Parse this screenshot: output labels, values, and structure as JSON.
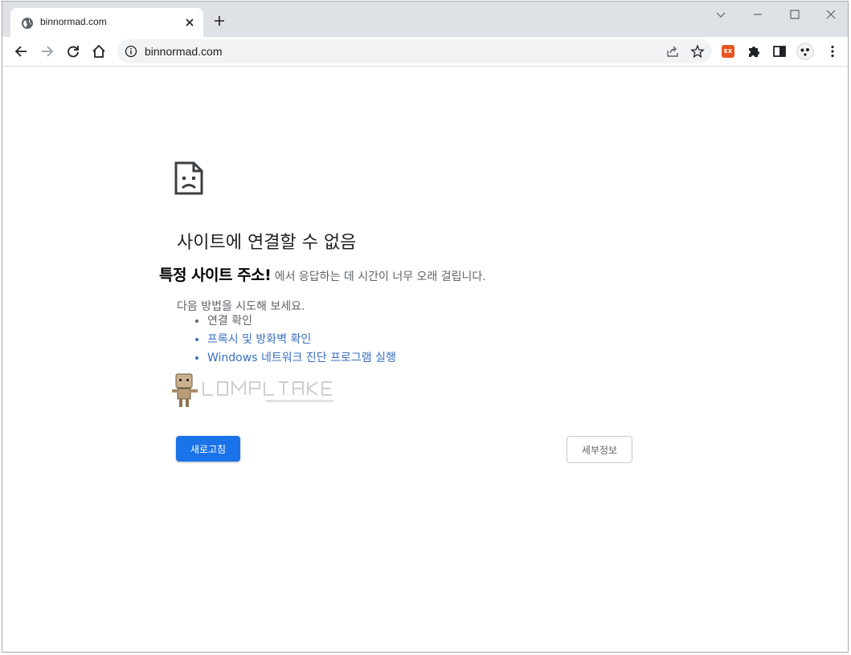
{
  "tab": {
    "title": "binnormad.com"
  },
  "omnibox": {
    "url": "binnormad.com"
  },
  "extension": {
    "badge": "EX",
    "badge_color": "#e8541f"
  },
  "error": {
    "heading": "사이트에 연결할 수 없음",
    "host": "특정 사이트 주소!",
    "message": " 에서 응답하는 데 시간이 너무 오래 걸립니다.",
    "try_label": "다음 방법을 시도해 보세요.",
    "suggestions": [
      {
        "label": "연결 확인",
        "link": false
      },
      {
        "label": "프록시 및 방화벽 확인",
        "link": true
      },
      {
        "label": "Windows 네트워크 진단 프로그램 실행",
        "link": true
      }
    ],
    "reload_label": "새로고침",
    "details_label": "세부정보"
  },
  "colors": {
    "accent": "#1a73e8",
    "link": "#3a6fc0",
    "tabstrip": "#dee1e6",
    "omnibox": "#f1f3f4"
  },
  "icons": {
    "favicon": "globe-icon",
    "tab_close": "close-icon",
    "new_tab": "plus-icon",
    "back": "arrow-left-icon",
    "forward": "arrow-right-icon",
    "reload": "reload-icon",
    "home": "home-icon",
    "site_info": "info-icon",
    "share": "share-icon",
    "bookmark": "star-icon",
    "extensions": "puzzle-icon",
    "side_panel": "side-panel-icon",
    "profile": "avatar-icon",
    "menu": "kebab-menu-icon",
    "error": "sad-page-icon"
  }
}
